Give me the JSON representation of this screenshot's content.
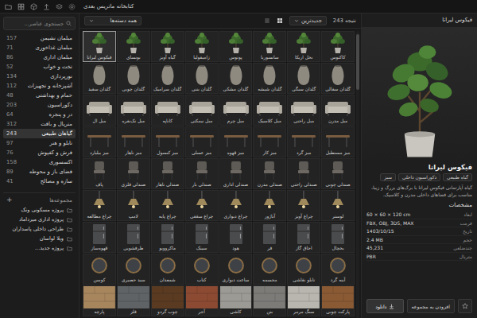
{
  "window": {
    "title": "کتابخانه ماتریس بعدی"
  },
  "sidebar": {
    "search": {
      "placeholder": "جستجوی عناصر..."
    },
    "categories": [
      {
        "label": "مبلمان نشیمن",
        "count": "157",
        "selected": false
      },
      {
        "label": "مبلمان غذاخوری",
        "count": "71",
        "selected": false
      },
      {
        "label": "مبلمان اداری",
        "count": "86",
        "selected": false
      },
      {
        "label": "تخت و خواب",
        "count": "52",
        "selected": false
      },
      {
        "label": "نورپردازی",
        "count": "134",
        "selected": false
      },
      {
        "label": "آشپزخانه و تجهیزات",
        "count": "112",
        "selected": false
      },
      {
        "label": "حمام و بهداشتی",
        "count": "48",
        "selected": false
      },
      {
        "label": "دکوراسیون",
        "count": "203",
        "selected": false
      },
      {
        "label": "در و پنجره",
        "count": "64",
        "selected": false
      },
      {
        "label": "متریال و بافت",
        "count": "312",
        "selected": false
      },
      {
        "label": "گیاهان طبیعی",
        "count": "243",
        "selected": true
      },
      {
        "label": "تابلو و هنر",
        "count": "97",
        "selected": false
      },
      {
        "label": "فرش و کفپوش",
        "count": "76",
        "selected": false
      },
      {
        "label": "اکسسوری",
        "count": "158",
        "selected": false
      },
      {
        "label": "فضای باز و محوطه",
        "count": "89",
        "selected": false
      },
      {
        "label": "سازه و مصالح",
        "count": "41",
        "selected": false
      }
    ],
    "collections_title": "مجموعه‌ها",
    "collections_add": "+",
    "collections": [
      {
        "label": "پروژه مسکونی ونک"
      },
      {
        "label": "پروژه اداری میرداماد"
      },
      {
        "label": "طراحی داخلی پاسداران"
      },
      {
        "label": "ویلا لواسان"
      },
      {
        "label": "پروژه جدید..."
      }
    ]
  },
  "browser": {
    "filter": "همه دسته‌ها",
    "sort": "جدیدترین",
    "result": "نتیجه 243",
    "items": [
      {
        "label": "کاکتوس",
        "kind": "plant",
        "selected": false
      },
      {
        "label": "نخل اریکا",
        "kind": "plant",
        "selected": false
      },
      {
        "label": "سانسوریا",
        "kind": "plant",
        "selected": false
      },
      {
        "label": "پوتوس",
        "kind": "plant",
        "selected": false
      },
      {
        "label": "زامیفولیا",
        "kind": "plant",
        "selected": false
      },
      {
        "label": "گیاه آویز",
        "kind": "plant",
        "selected": false
      },
      {
        "label": "بونسای",
        "kind": "plant",
        "selected": false
      },
      {
        "label": "فیکوس لیراتا",
        "kind": "plant",
        "selected": true
      },
      {
        "label": "گلدان سفالی",
        "kind": "vase",
        "selected": false
      },
      {
        "label": "گلدان سنگی",
        "kind": "vase",
        "selected": false
      },
      {
        "label": "گلدان شیشه",
        "kind": "vase",
        "selected": false
      },
      {
        "label": "گلدان مشکی",
        "kind": "vase",
        "selected": false
      },
      {
        "label": "گلدان بتنی",
        "kind": "vase",
        "selected": false
      },
      {
        "label": "گلدان سرامیک",
        "kind": "vase",
        "selected": false
      },
      {
        "label": "گلدان چوبی",
        "kind": "vase",
        "selected": false
      },
      {
        "label": "گلدان سفید",
        "kind": "vase",
        "selected": false
      },
      {
        "label": "مبل مدرن",
        "kind": "sofa",
        "selected": false
      },
      {
        "label": "مبل راحتی",
        "kind": "sofa",
        "selected": false
      },
      {
        "label": "مبل کلاسیک",
        "kind": "sofa",
        "selected": false
      },
      {
        "label": "مبل چرم",
        "kind": "sofa",
        "selected": false
      },
      {
        "label": "مبل نیمکتی",
        "kind": "sofa",
        "selected": false
      },
      {
        "label": "کاناپه",
        "kind": "sofa",
        "selected": false
      },
      {
        "label": "مبل تک‌نفره",
        "kind": "sofa",
        "selected": false
      },
      {
        "label": "مبل ال",
        "kind": "sofa",
        "selected": false
      },
      {
        "label": "میز مستطیل",
        "kind": "table",
        "selected": false
      },
      {
        "label": "میز گرد",
        "kind": "table",
        "selected": false
      },
      {
        "label": "میز کار",
        "kind": "table",
        "selected": false
      },
      {
        "label": "میز قهوه",
        "kind": "table",
        "selected": false
      },
      {
        "label": "میز عسلی",
        "kind": "table",
        "selected": false
      },
      {
        "label": "میز کنسول",
        "kind": "table",
        "selected": false
      },
      {
        "label": "میز ناهار",
        "kind": "table",
        "selected": false
      },
      {
        "label": "میز بیلیارد",
        "kind": "table",
        "selected": false
      },
      {
        "label": "صندلی چوبی",
        "kind": "chair",
        "selected": false
      },
      {
        "label": "صندلی راحتی",
        "kind": "chair",
        "selected": false
      },
      {
        "label": "صندلی مدرن",
        "kind": "chair",
        "selected": false
      },
      {
        "label": "صندلی اداری",
        "kind": "chair",
        "selected": false
      },
      {
        "label": "صندلی بار",
        "kind": "chair",
        "selected": false
      },
      {
        "label": "صندلی ناهار",
        "kind": "chair",
        "selected": false
      },
      {
        "label": "صندلی فلزی",
        "kind": "chair",
        "selected": false
      },
      {
        "label": "پاف",
        "kind": "chair",
        "selected": false
      },
      {
        "label": "لوستر",
        "kind": "lamp",
        "selected": false
      },
      {
        "label": "چراغ آویز",
        "kind": "lamp",
        "selected": false
      },
      {
        "label": "آباژور",
        "kind": "lamp",
        "selected": false
      },
      {
        "label": "چراغ دیواری",
        "kind": "lamp",
        "selected": false
      },
      {
        "label": "چراغ سقفی",
        "kind": "lamp",
        "selected": false
      },
      {
        "label": "چراغ پایه",
        "kind": "lamp",
        "selected": false
      },
      {
        "label": "لامپ",
        "kind": "lamp",
        "selected": false
      },
      {
        "label": "چراغ مطالعه",
        "kind": "lamp",
        "selected": false
      },
      {
        "label": "یخچال",
        "kind": "appliance",
        "selected": false
      },
      {
        "label": "اجاق گاز",
        "kind": "appliance",
        "selected": false
      },
      {
        "label": "فر",
        "kind": "appliance",
        "selected": false
      },
      {
        "label": "هود",
        "kind": "appliance",
        "selected": false
      },
      {
        "label": "سینک",
        "kind": "appliance",
        "selected": false
      },
      {
        "label": "ماکروویو",
        "kind": "appliance",
        "selected": false
      },
      {
        "label": "ظرفشویی",
        "kind": "appliance",
        "selected": false
      },
      {
        "label": "قهوه‌ساز",
        "kind": "appliance",
        "selected": false
      },
      {
        "label": "آینه گرد",
        "kind": "decor",
        "selected": false
      },
      {
        "label": "تابلو نقاشی",
        "kind": "decor",
        "selected": false
      },
      {
        "label": "مجسمه",
        "kind": "decor",
        "selected": false
      },
      {
        "label": "ساعت دیواری",
        "kind": "decor",
        "selected": false
      },
      {
        "label": "کتاب",
        "kind": "decor",
        "selected": false
      },
      {
        "label": "شمعدان",
        "kind": "decor",
        "selected": false
      },
      {
        "label": "سبد حصیری",
        "kind": "decor",
        "selected": false
      },
      {
        "label": "کوسن",
        "kind": "decor",
        "selected": false
      },
      {
        "label": "پارکت چوبی",
        "kind": "material",
        "selected": false,
        "color": "#8a5a34"
      },
      {
        "label": "سنگ مرمر",
        "kind": "material",
        "selected": false,
        "color": "#b9b6b0"
      },
      {
        "label": "بتن",
        "kind": "material",
        "selected": false,
        "color": "#7d7b78"
      },
      {
        "label": "کاشی",
        "kind": "material",
        "selected": false,
        "color": "#9c9a95"
      },
      {
        "label": "آجر",
        "kind": "material",
        "selected": false,
        "color": "#8c4a32"
      },
      {
        "label": "چوب گردو",
        "kind": "material",
        "selected": false,
        "color": "#5a3b22"
      },
      {
        "label": "فلز",
        "kind": "material",
        "selected": false,
        "color": "#5f6366"
      },
      {
        "label": "پارچه",
        "kind": "material",
        "selected": false,
        "color": "#a7865e"
      }
    ]
  },
  "details": {
    "header": "فیکوس لیراتا",
    "title": "فیکوس لیراتا",
    "tags": [
      "گیاه طبیعی",
      "دکوراسیون داخلی",
      "سبز"
    ],
    "description": "گیاه آپارتمانی فیکوس لیراتا با برگ‌های بزرگ و زیبا، مناسب برای فضاهای داخلی مدرن و کلاسیک.",
    "specs_title": "مشخصات",
    "specs": [
      {
        "label": "ابعاد",
        "value": "60 × 60 × 120 cm"
      },
      {
        "label": "فرمت",
        "value": "FBX, OBJ, 3DS, MAX"
      },
      {
        "label": "تاریخ",
        "value": "1403/10/15"
      },
      {
        "label": "حجم",
        "value": "2.4 MB"
      },
      {
        "label": "چندضلعی",
        "value": "45,231"
      },
      {
        "label": "متریال",
        "value": "PBR"
      }
    ],
    "add": "افزودن به مجموعه",
    "download": "دانلود"
  }
}
